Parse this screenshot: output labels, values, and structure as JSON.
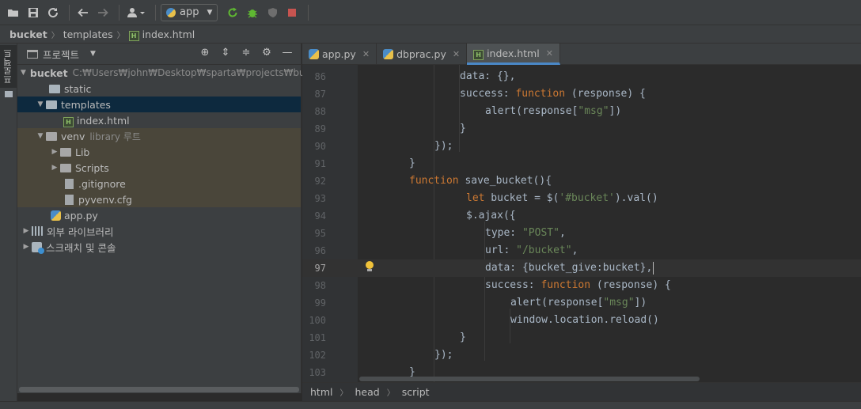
{
  "toolbar": {
    "run_config": "app",
    "icons": [
      "open-folder-icon",
      "save-icon",
      "sync-icon",
      "back-arrow-icon",
      "forward-arrow-icon",
      "user-icon",
      "run-icon",
      "debug-icon",
      "coverage-icon",
      "stop-icon"
    ],
    "colors": {
      "run": "#499c54",
      "debug": "#5fb832",
      "stop": "#c75450"
    }
  },
  "breadcrumb": {
    "project": "bucket",
    "folder": "templates",
    "file": "index.html"
  },
  "left_strip": {
    "tab_label": "프로젝트"
  },
  "project_panel": {
    "title": "프로젝트",
    "tree": {
      "root_name": "bucket",
      "root_path": "C:₩Users₩john₩Desktop₩sparta₩projects₩bucket",
      "static": "static",
      "templates": "templates",
      "index": "index.html",
      "venv": "venv",
      "venv_note": "library 루트",
      "lib": "Lib",
      "scripts": "Scripts",
      "gitignore": ".gitignore",
      "pyvenv": "pyvenv.cfg",
      "app": "app.py",
      "external": "외부 라이브러리",
      "scratches": "스크래치 및 콘솔"
    }
  },
  "tabs": [
    {
      "label": "app.py",
      "active": false
    },
    {
      "label": "dbprac.py",
      "active": false
    },
    {
      "label": "index.html",
      "active": true
    }
  ],
  "editor": {
    "lines": [
      {
        "n": "86",
        "text": "data: {},"
      },
      {
        "n": "87",
        "text": "success: function (response) {"
      },
      {
        "n": "88",
        "text": "alert(response[\"msg\"])"
      },
      {
        "n": "89",
        "text": "}"
      },
      {
        "n": "90",
        "text": "});"
      },
      {
        "n": "91",
        "text": "}"
      },
      {
        "n": "92",
        "text": "function save_bucket(){"
      },
      {
        "n": "93",
        "text": "let bucket = $('#bucket').val()"
      },
      {
        "n": "94",
        "text": "$.ajax({"
      },
      {
        "n": "95",
        "text": "type: \"POST\","
      },
      {
        "n": "96",
        "text": "url: \"/bucket\","
      },
      {
        "n": "97",
        "text": "data: {bucket_give:bucket},"
      },
      {
        "n": "98",
        "text": "success: function (response) {"
      },
      {
        "n": "99",
        "text": "alert(response[\"msg\"])"
      },
      {
        "n": "100",
        "text": "window.location.reload()"
      },
      {
        "n": "101",
        "text": "}"
      },
      {
        "n": "102",
        "text": "});"
      },
      {
        "n": "103",
        "text": "}"
      }
    ],
    "current_line": "97"
  },
  "code_breadcrumb": [
    "html",
    "head",
    "script"
  ]
}
